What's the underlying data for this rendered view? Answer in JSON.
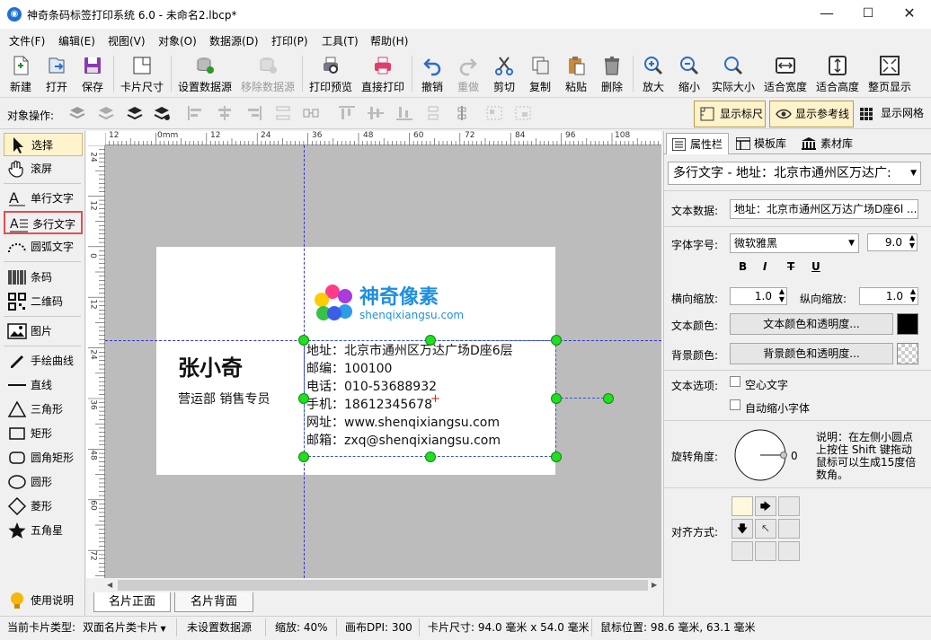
{
  "window": {
    "title": "神奇条码标签打印系统 6.0 - 未命名2.lbcp*",
    "minimize": "—",
    "maximize": "☐",
    "close": "✕"
  },
  "menu": [
    "文件(F)",
    "编辑(E)",
    "视图(V)",
    "对象(O)",
    "数据源(D)",
    "打印(P)",
    "工具(T)",
    "帮助(H)"
  ],
  "toolbar": {
    "new": "新建",
    "open": "打开",
    "save": "保存",
    "card_size": "卡片尺寸",
    "set_datasource": "设置数据源",
    "remove_datasource": "移除数据源",
    "print_preview": "打印预览",
    "direct_print": "直接打印",
    "undo": "撤销",
    "redo": "重做",
    "cut": "剪切",
    "copy": "复制",
    "paste": "粘贴",
    "delete": "删除",
    "zoom_in": "放大",
    "zoom_out": "缩小",
    "actual_size": "实际大小",
    "fit_width": "适合宽度",
    "fit_height": "适合高度",
    "full_page": "整页显示"
  },
  "objops": {
    "label": "对象操作:",
    "show_ruler": "显示标尺",
    "show_guides": "显示参考线",
    "show_grid": "显示网格"
  },
  "tools": {
    "select": "选择",
    "scroll": "滚屏",
    "single_text": "单行文字",
    "multi_text": "多行文字",
    "arc_text": "圆弧文字",
    "barcode": "条码",
    "qrcode": "二维码",
    "image": "图片",
    "freehand": "手绘曲线",
    "line": "直线",
    "triangle": "三角形",
    "rect": "矩形",
    "roundrect": "圆角矩形",
    "circle": "圆形",
    "diamond": "菱形",
    "star": "五角星",
    "help": "使用说明"
  },
  "ruler": {
    "top": [
      "12",
      "0mm",
      "12",
      "24",
      "36",
      "48",
      "60",
      "72",
      "84",
      "96",
      "108"
    ],
    "left": [
      "24",
      "12",
      "0",
      "12",
      "24",
      "36",
      "48",
      "60",
      "72"
    ]
  },
  "card": {
    "brand_cn": "神奇像素",
    "brand_en": "shenqixiangsu.com",
    "name": "张小奇",
    "position": "营运部 销售专员",
    "lines": [
      "地址：北京市通州区万达广场D座6层",
      "邮编：100100",
      "电话：010-53688932",
      "手机：18612345678",
      "网址：www.shenqixiangsu.com",
      "邮箱：zxq@shenqixiangsu.com"
    ],
    "logo_colors": [
      "#ff3b8a",
      "#a83bd9",
      "#ffcc00",
      "#2c9be8",
      "#35c24a",
      "#3b5de8"
    ]
  },
  "pagetabs": [
    "名片正面",
    "名片背面"
  ],
  "right": {
    "tabs": [
      "属性栏",
      "模板库",
      "素材库"
    ],
    "object_select": "多行文字 - 地址：北京市通州区万达广:",
    "text_data_label": "文本数据:",
    "text_data": "地址：北京市通州区万达广场D座6l ...",
    "font_label": "字体字号:",
    "font": "微软雅黑",
    "font_size": "9.0",
    "style_buttons": [
      "B",
      "I",
      "T",
      "U"
    ],
    "hscale_label": "横向缩放:",
    "hscale": "1.0",
    "vscale_label": "纵向缩放:",
    "vscale": "1.0",
    "textcolor_label": "文本颜色:",
    "textcolor_btn": "文本颜色和透明度...",
    "bgcolor_label": "背景颜色:",
    "bgcolor_btn": "背景颜色和透明度...",
    "options_label": "文本选项:",
    "hollow": "空心文字",
    "autoshrink": "自动缩小字体",
    "rotate_label": "旋转角度:",
    "rotate_value": "0",
    "rotate_note": "说明：在左侧小圆点上按住 Shift 键拖动鼠标可以生成15度倍数角。",
    "align_label": "对齐方式:"
  },
  "status": {
    "card_type": "当前卡片类型:",
    "card_type_value": "双面名片类卡片",
    "datasource": "未设置数据源",
    "zoom": "缩放: 40%",
    "dpi": "画布DPI: 300",
    "card_size": "卡片尺寸: 94.0 毫米 x 54.0 毫米",
    "mouse": "鼠标位置: 98.6 毫米, 63.1 毫米"
  }
}
